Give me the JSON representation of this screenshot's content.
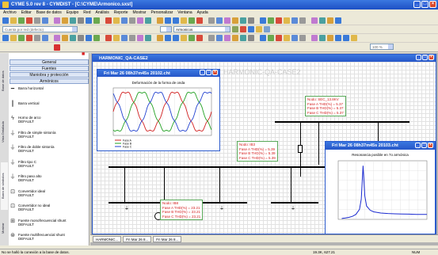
{
  "app": {
    "title": "CYME 5.0 rev 8 - CYMDIST - [C:\\CYME\\Armonico.sxst]",
    "window_buttons": [
      "_",
      "□",
      "×"
    ]
  },
  "menu": [
    "Archivo",
    "Editar",
    "Base de datos",
    "Equipo",
    "Red",
    "Análisis",
    "Reporte",
    "Mostrar",
    "Personalizar",
    "Ventana",
    "Ayuda"
  ],
  "toolbar": {
    "combo1": "Cuenta por red (defecto)",
    "combo2": "Armonicos",
    "combo3": "100 %"
  },
  "sidebar": {
    "vertical_tabs": [
      "Base de datos",
      "Vista Detallada",
      "Barra de símbolos",
      "Mostrar"
    ],
    "nav_buttons": [
      "General",
      "Fuentes",
      "Maniobra y protección",
      "Armónicos"
    ],
    "items": [
      {
        "label": "Barra horizontal",
        "sub": "",
        "icon": "hbar-icon",
        "glyph": "━"
      },
      {
        "label": "Barra vertical",
        "sub": "",
        "icon": "vbar-icon",
        "glyph": "┃"
      },
      {
        "label": "Horno de arco",
        "sub": "DEFAULT",
        "icon": "arc-furnace-icon",
        "glyph": "ϟ"
      },
      {
        "label": "Filtro de simple sintonía",
        "sub": "DEFAULT",
        "icon": "single-filter-icon",
        "glyph": "⏚"
      },
      {
        "label": "Filtro de doble sintonía",
        "sub": "DEFAULT",
        "icon": "double-filter-icon",
        "glyph": "⏚"
      },
      {
        "label": "Filtro tipo C",
        "sub": "DEFAULT",
        "icon": "c-filter-icon",
        "glyph": "⏚"
      },
      {
        "label": "Filtro paso alto",
        "sub": "DEFAULT",
        "icon": "highpass-filter-icon",
        "glyph": "⏚"
      },
      {
        "label": "Convertidor ideal",
        "sub": "DEFAULT",
        "icon": "ideal-converter-icon",
        "glyph": "⊡"
      },
      {
        "label": "Convertidor no ideal",
        "sub": "DEFAULT",
        "icon": "nonideal-converter-icon",
        "glyph": "⊡"
      },
      {
        "label": "Fuente monofrecuencial shunt",
        "sub": "DEFAULT",
        "icon": "mono-source-icon",
        "glyph": "⊞"
      },
      {
        "label": "Fuente multifrecuencial shunt",
        "sub": "DEFAULT",
        "icon": "multi-source-icon",
        "glyph": "⊛"
      }
    ]
  },
  "main_window": {
    "title": "HARMONIC_QA-CASE2",
    "watermark": "HARMONIC-QA-CASE2",
    "annotations": [
      {
        "lines": [
          "Nodo: SEC_13.8KV",
          "Fase A THD(%) = 5.37",
          "Fase B THD(%) = 5.37",
          "Fase C THD(%) = 5.37"
        ]
      },
      {
        "lines": [
          "Nodo: IB3",
          "Fase A THD(%) = 5.39",
          "Fase B THD(%) = 5.39",
          "Fase C THD(%) = 5.39"
        ]
      },
      {
        "lines": [
          "Nodo: IB8",
          "Fase A THD(%) = 23.21",
          "Fase B THD(%) = 23.21",
          "Fase C THD(%) = 23.21"
        ]
      }
    ]
  },
  "chart_window_1": {
    "title": "Fri Mar 26 08h37m45s 20102.cht",
    "chart_title": "Deformación de la forma de onda",
    "legend": [
      "Fase A",
      "Fase B",
      "Fase C"
    ],
    "colors": {
      "a": "#d22020",
      "b": "#20a020",
      "c": "#2040d0"
    }
  },
  "chart_window_2": {
    "title": "Fri Mar 26 08h37m45s 20103.cht",
    "chart_title": "Resonancia posible en 7o armónica",
    "color": "#1a2ad0"
  },
  "chart_data": [
    {
      "type": "line",
      "title": "Deformación de la forma de onda",
      "series": [
        {
          "name": "Fase A",
          "phase_deg": 0
        },
        {
          "name": "Fase B",
          "phase_deg": -120
        },
        {
          "name": "Fase C",
          "phase_deg": 120
        }
      ],
      "cycles": 2,
      "harmonic_7_ratio": 0.06,
      "ylim": [
        -1.2,
        1.2
      ],
      "grid": true,
      "legend_placement": "bottom-left"
    },
    {
      "type": "line",
      "title": "Resonancia posible en 7o armónica",
      "series": [
        {
          "x": [
            1,
            2,
            3,
            4,
            5,
            6,
            6.5,
            7,
            7.5,
            8,
            9,
            10,
            12,
            14,
            16,
            18,
            20,
            22,
            25
          ],
          "values": [
            0.05,
            0.08,
            0.12,
            0.18,
            0.3,
            0.6,
            1.2,
            3.2,
            1.4,
            0.8,
            0.55,
            0.45,
            0.38,
            0.35,
            0.33,
            0.32,
            0.31,
            0.3,
            0.3
          ]
        }
      ],
      "xlim": [
        0,
        25
      ],
      "ylim": [
        0,
        3.5
      ],
      "grid": true
    }
  ],
  "taskbar": [
    "HARMONIC...",
    "Fri Mar 26 8...",
    "Fri Mar 26 8..."
  ],
  "statusbar": {
    "message": "No se halló la conexión a la base de datos.",
    "coords": "19.3K, 627.21",
    "mode": "NUM"
  }
}
